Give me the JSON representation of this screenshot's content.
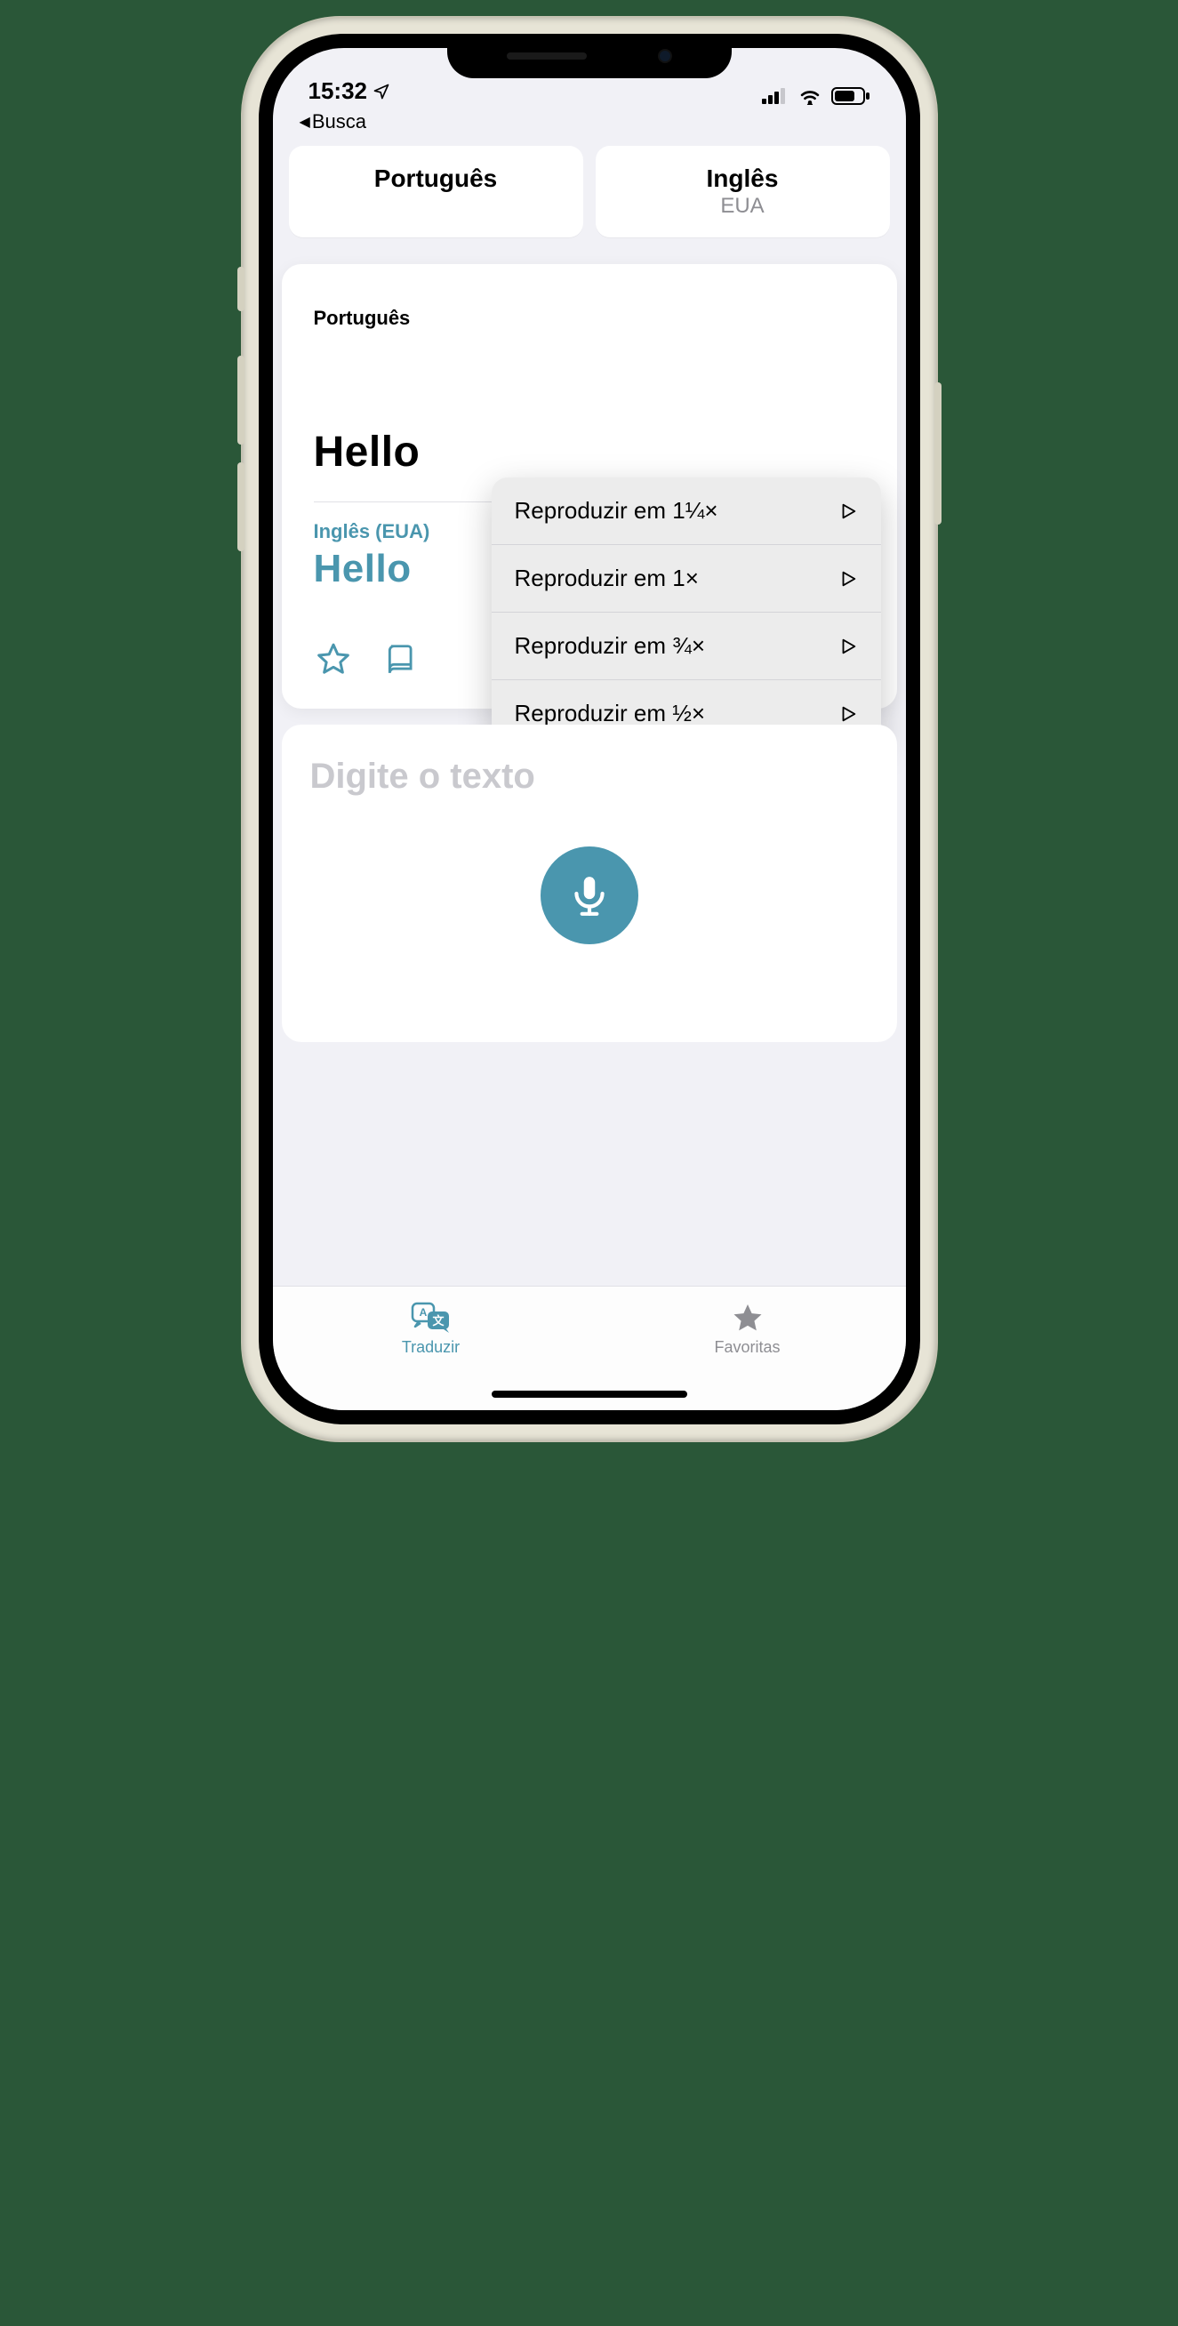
{
  "status": {
    "time": "15:32",
    "breadcrumb_prefix": "◀",
    "breadcrumb_label": "Busca"
  },
  "languages": {
    "source": {
      "name": "Português",
      "region": ""
    },
    "target": {
      "name": "Inglês",
      "region": "EUA"
    }
  },
  "translation": {
    "source_label": "Português",
    "source_text": "Hello",
    "target_label": "Inglês (EUA)",
    "target_text": "Hello"
  },
  "speed_menu": {
    "items": [
      {
        "label": "Reproduzir em 1¼×"
      },
      {
        "label": "Reproduzir em 1×"
      },
      {
        "label": "Reproduzir em ¾×"
      },
      {
        "label": "Reproduzir em ½×"
      }
    ]
  },
  "input": {
    "placeholder": "Digite o texto"
  },
  "tabs": {
    "translate": "Traduzir",
    "favorites": "Favoritas"
  }
}
